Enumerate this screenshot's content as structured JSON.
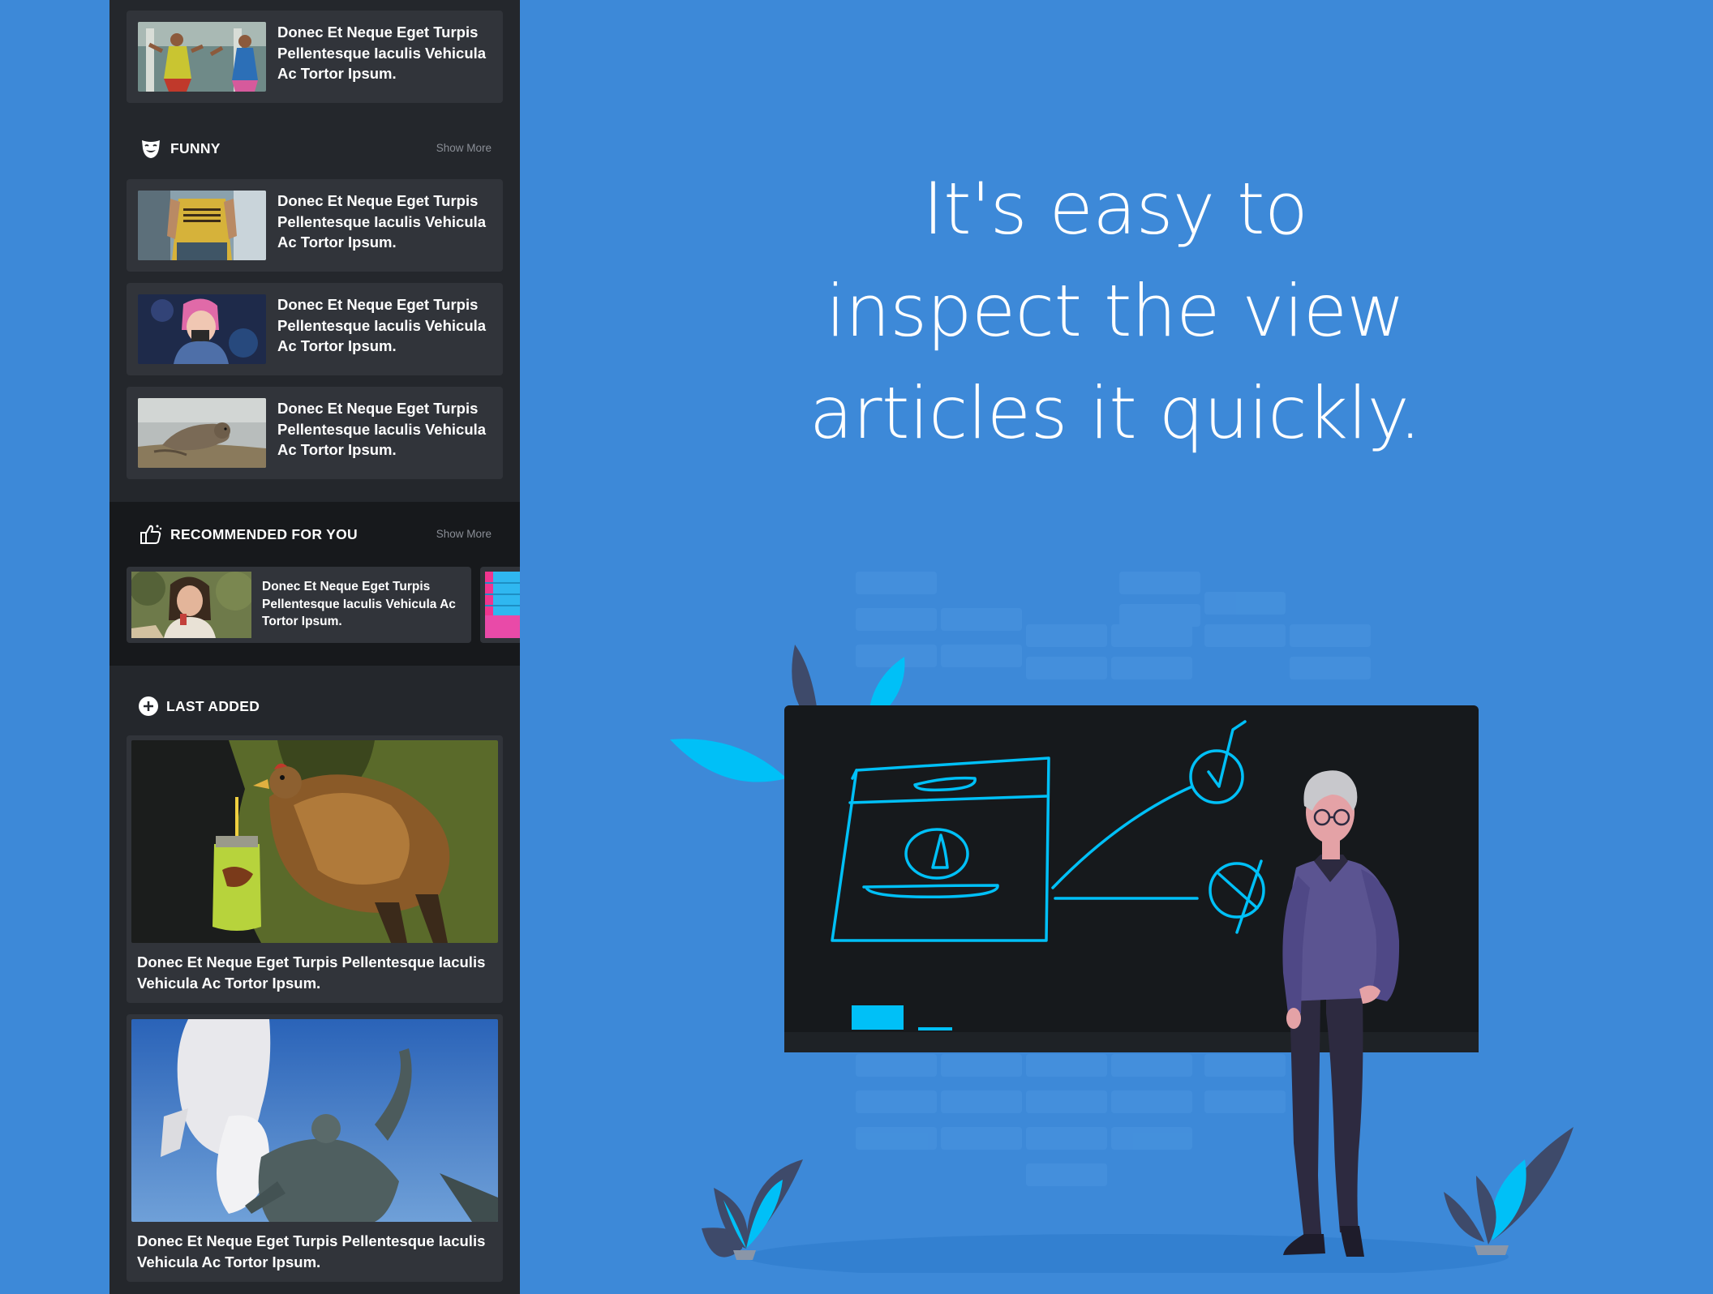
{
  "sidebar": {
    "article_text": "Donec Et Neque Eget Turpis Pellentesque Iaculis Vehicula Ac Tortor Ipsum.",
    "sections": {
      "funny": {
        "title": "FUNNY",
        "more": "Show More",
        "icon": "mask-icon"
      },
      "recommended": {
        "title": "RECOMMENDED FOR YOU",
        "more": "Show More",
        "icon": "thumbs-up-icon"
      },
      "last_added": {
        "title": "LAST ADDED",
        "icon": "plus-circle-icon"
      }
    },
    "top_card": {
      "text": "Donec Et Neque Eget Turpis Pellentesque Iaculis Vehicula Ac Tortor Ipsum.",
      "image": "dancers-photo"
    },
    "funny_cards": [
      {
        "text": "Donec Et Neque Eget Turpis Pellentesque Iaculis Vehicula Ac Tortor Ipsum.",
        "image": "pancakes-shirt-photo"
      },
      {
        "text": "Donec Et Neque Eget Turpis Pellentesque Iaculis Vehicula Ac Tortor Ipsum.",
        "image": "child-photo"
      },
      {
        "text": "Donec Et Neque Eget Turpis Pellentesque Iaculis Vehicula Ac Tortor Ipsum.",
        "image": "seal-photo"
      }
    ],
    "recommended_cards": [
      {
        "text": "Donec Et Neque Eget Turpis Pellentesque Iaculis Vehicula Ac Tortor Ipsum.",
        "image": "woman-photo"
      }
    ],
    "last_added_cards": [
      {
        "text": "Donec Et Neque Eget Turpis Pellentesque Iaculis Vehicula Ac Tortor Ipsum.",
        "image": "chicken-photo"
      },
      {
        "text": "Donec Et Neque Eget Turpis Pellentesque Iaculis Vehicula Ac Tortor Ipsum.",
        "image": "statue-photo"
      }
    ]
  },
  "headline": {
    "lines": [
      "It's easy to",
      "inspect the view",
      "articles it quickly."
    ]
  },
  "colors": {
    "background": "#3d89d8",
    "panel": "#24272c",
    "card": "#31343a",
    "accent": "#00c0f7",
    "board": "#16191c"
  }
}
